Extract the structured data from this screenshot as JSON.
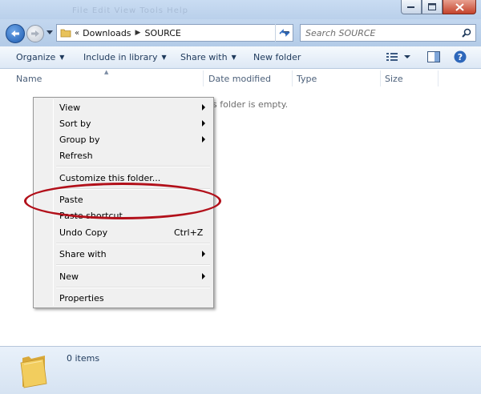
{
  "window": {
    "title_ghost": "File Edit View Tools Help"
  },
  "address": {
    "chevron": "«",
    "crumbs": [
      "Downloads",
      "SOURCE"
    ]
  },
  "search": {
    "placeholder": "Search SOURCE"
  },
  "toolbar": {
    "organize": "Organize",
    "include_library": "Include in library",
    "share_with": "Share with",
    "new_folder": "New folder"
  },
  "columns": {
    "name": "Name",
    "date_modified": "Date modified",
    "type": "Type",
    "size": "Size"
  },
  "content": {
    "empty_message": "s folder is empty."
  },
  "context_menu": {
    "view": "View",
    "sort_by": "Sort by",
    "group_by": "Group by",
    "refresh": "Refresh",
    "customize": "Customize this folder...",
    "paste": "Paste",
    "paste_shortcut": "Paste shortcut",
    "undo_copy": "Undo Copy",
    "undo_copy_shortcut": "Ctrl+Z",
    "share_with": "Share with",
    "new": "New",
    "properties": "Properties"
  },
  "details": {
    "item_count": "0 items"
  },
  "colors": {
    "highlight_ellipse": "#b2101a",
    "toolbar_text": "#1e395b"
  }
}
